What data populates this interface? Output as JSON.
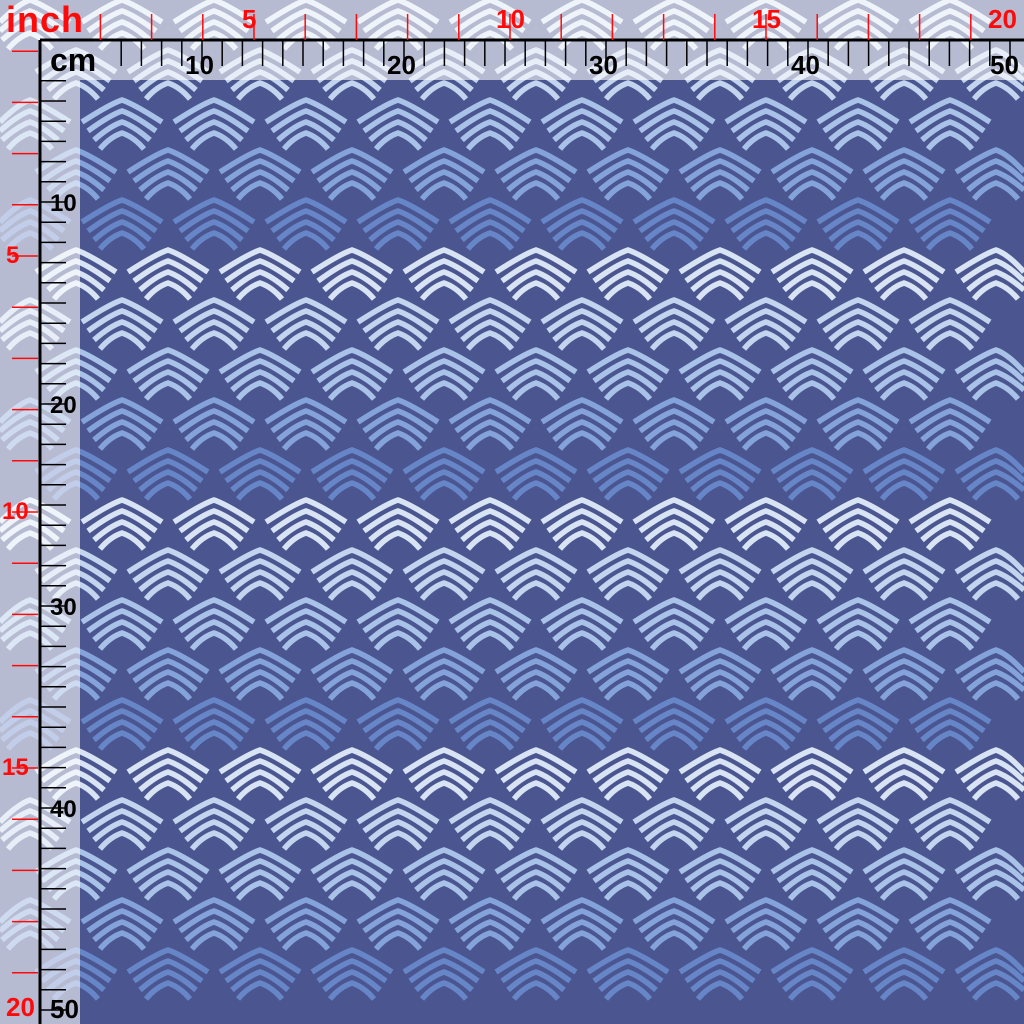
{
  "ruler": {
    "inch_label": "inch",
    "cm_label": "cm",
    "top_inch_labels": [
      "5",
      "10",
      "15",
      "20"
    ],
    "top_cm_labels": [
      "10",
      "20",
      "30",
      "40",
      "50"
    ],
    "left_inch_labels": [
      "5",
      "10",
      "15",
      "20"
    ],
    "left_cm_labels": [
      "10",
      "20",
      "30",
      "40",
      "50"
    ]
  },
  "colors": {
    "fabric_bg": "#4b5590",
    "inch_red": "#ff0a0a",
    "wave_band": [
      "#d8e4f3",
      "#c2d4ee",
      "#a9c2e8",
      "#84a3da",
      "#6786c8"
    ]
  }
}
